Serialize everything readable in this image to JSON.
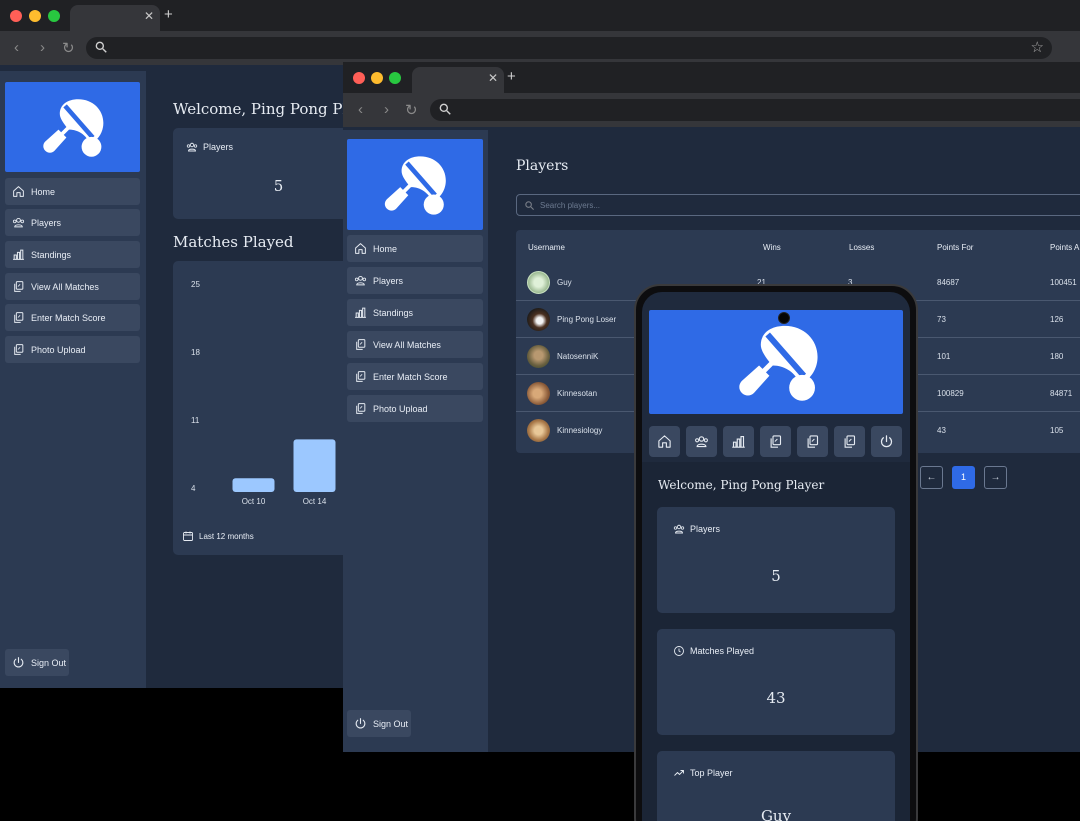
{
  "back_window": {
    "sidebar": {
      "items": [
        "Home",
        "Players",
        "Standings",
        "View All Matches",
        "Enter Match Score",
        "Photo Upload"
      ],
      "sign_out": "Sign Out"
    },
    "main": {
      "welcome": "Welcome, Ping Pong Player",
      "players_card": {
        "title": "Players",
        "value": "5"
      },
      "matches_heading": "Matches Played",
      "footer": "Last 12 months",
      "chart_data": {
        "type": "bar",
        "categories": [
          "Oct 10",
          "Oct 14"
        ],
        "values": [
          5,
          9
        ],
        "y_ticks": [
          25,
          18,
          11,
          4
        ],
        "ylim": [
          4,
          25
        ],
        "bar_color": "#9cc8ff"
      }
    }
  },
  "middle_window": {
    "sidebar": {
      "items": [
        "Home",
        "Players",
        "Standings",
        "View All Matches",
        "Enter Match Score",
        "Photo Upload"
      ],
      "sign_out": "Sign Out"
    },
    "main": {
      "title": "Players",
      "search_placeholder": "Search players...",
      "columns": [
        "Username",
        "Wins",
        "Losses",
        "Points For",
        "Points A"
      ],
      "rows": [
        {
          "username": "Guy",
          "wins": "21",
          "losses": "3",
          "points_for": "84687",
          "points_against": "100451"
        },
        {
          "username": "Ping Pong Loser",
          "wins": "",
          "losses": "",
          "points_for": "73",
          "points_against": "126"
        },
        {
          "username": "NatosenniK",
          "wins": "",
          "losses": "",
          "points_for": "101",
          "points_against": "180"
        },
        {
          "username": "Kinnesotan",
          "wins": "",
          "losses": "",
          "points_for": "100829",
          "points_against": "84871"
        },
        {
          "username": "Kinnesiology",
          "wins": "",
          "losses": "",
          "points_for": "43",
          "points_against": "105"
        }
      ],
      "pagination": {
        "prev": "←",
        "current": "1",
        "next": "→"
      }
    }
  },
  "phone": {
    "welcome": "Welcome, Ping Pong Player",
    "cards": [
      {
        "title": "Players",
        "value": "5"
      },
      {
        "title": "Matches Played",
        "value": "43"
      },
      {
        "title": "Top Player",
        "value": "Guy"
      }
    ]
  },
  "colors": {
    "accent": "#2f6ae6",
    "sidebar": "#2c3a52",
    "background": "#1f2a3d",
    "nav_item": "#3a4860"
  }
}
